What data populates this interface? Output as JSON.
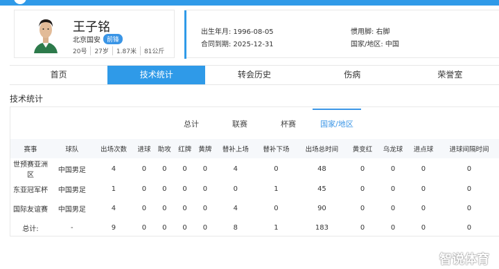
{
  "player": {
    "name": "王子铭",
    "club": "北京国安",
    "position_badge": "前锋",
    "number": "20号",
    "age": "27岁",
    "height": "1.87米",
    "weight": "81公斤"
  },
  "info": {
    "birth": "出生年月: 1996-08-05",
    "contract": "合同到期: 2025-12-31",
    "foot": "惯用脚: 右脚",
    "nation": "国家/地区: 中国"
  },
  "tabs": [
    "首页",
    "技术统计",
    "转会历史",
    "伤病",
    "荣誉室"
  ],
  "section_title": "技术统计",
  "subtabs": [
    "总计",
    "联赛",
    "杯赛",
    "国家/地区"
  ],
  "table": {
    "headers": [
      "赛事",
      "球队",
      "出场次数",
      "进球",
      "助攻",
      "红牌",
      "黄牌",
      "替补上场",
      "替补下场",
      "出场总时间",
      "黄变红",
      "乌龙球",
      "进点球",
      "进球间隔时间"
    ],
    "rows": [
      [
        "世预赛亚洲区",
        "中国男足",
        "4",
        "0",
        "0",
        "0",
        "0",
        "4",
        "0",
        "48",
        "0",
        "0",
        "0",
        "0"
      ],
      [
        "东亚冠军杯",
        "中国男足",
        "1",
        "0",
        "0",
        "0",
        "0",
        "0",
        "1",
        "45",
        "0",
        "0",
        "0",
        "0"
      ],
      [
        "国际友谊赛",
        "中国男足",
        "4",
        "0",
        "0",
        "0",
        "0",
        "4",
        "0",
        "90",
        "0",
        "0",
        "0",
        "0"
      ],
      [
        "总计:",
        "-",
        "9",
        "0",
        "0",
        "0",
        "0",
        "8",
        "1",
        "183",
        "0",
        "0",
        "0",
        "0"
      ]
    ]
  },
  "watermark": "智说体育",
  "colors": {
    "accent": "#2f9ae8",
    "header_bg": "#f6f8fb"
  },
  "icons": {
    "logo": "site-logo-icon",
    "avatar": "player-photo"
  }
}
